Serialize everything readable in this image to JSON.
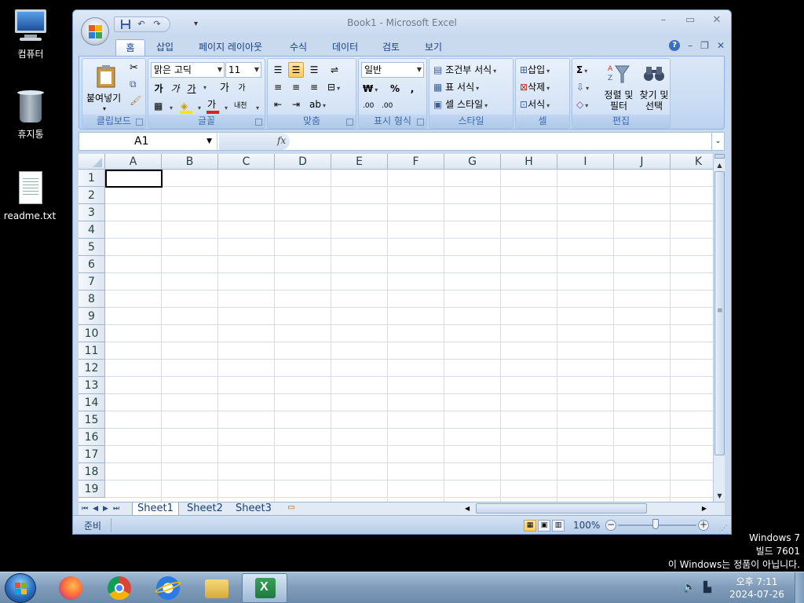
{
  "desktop": {
    "icons": [
      {
        "label": "컴퓨터"
      },
      {
        "label": "휴지통"
      },
      {
        "label": "readme.txt"
      }
    ],
    "watermark": {
      "line1": "Windows 7",
      "line2": "빌드 7601",
      "line3": "이 Windows는 정품이 아닙니다."
    }
  },
  "excel": {
    "title": "Book1 - Microsoft Excel",
    "tabs": [
      "홈",
      "삽입",
      "페이지 레이아웃",
      "수식",
      "데이터",
      "검토",
      "보기"
    ],
    "active_tab": "홈",
    "ribbon": {
      "clipboard": {
        "label": "클립보드",
        "paste": "붙여넣기"
      },
      "font": {
        "label": "글꼴",
        "font_name": "맑은 고딕",
        "font_size": "11",
        "bold": "가",
        "italic": "가",
        "underline": "가",
        "grow": "가",
        "shrink": "가",
        "font_color": "가",
        "phonetic": "내천"
      },
      "alignment": {
        "label": "맞춤"
      },
      "number": {
        "label": "표시 형식",
        "format": "일반",
        "currency": "₩",
        "percent": "%",
        "comma": ",",
        "inc_decimal": ".00",
        "dec_decimal": ".00"
      },
      "styles": {
        "label": "스타일",
        "conditional": "조건부 서식",
        "table": "표 서식",
        "cell": "셀 스타일"
      },
      "cells": {
        "label": "셀",
        "insert": "삽입",
        "delete": "삭제",
        "format": "서식"
      },
      "editing": {
        "label": "편집",
        "sort_line1": "정렬 및",
        "sort_line2": "필터",
        "find_line1": "찾기 및",
        "find_line2": "선택"
      }
    },
    "formula_bar": {
      "name_box": "A1",
      "fx": "fx",
      "formula": ""
    },
    "columns": [
      "A",
      "B",
      "C",
      "D",
      "E",
      "F",
      "G",
      "H",
      "I",
      "J",
      "K"
    ],
    "rows": [
      "1",
      "2",
      "3",
      "4",
      "5",
      "6",
      "7",
      "8",
      "9",
      "10",
      "11",
      "12",
      "13",
      "14",
      "15",
      "16",
      "17",
      "18",
      "19"
    ],
    "sheets": [
      "Sheet1",
      "Sheet2",
      "Sheet3"
    ],
    "active_sheet": "Sheet1",
    "status": {
      "text": "준비",
      "zoom": "100%"
    }
  },
  "taskbar": {
    "apps": [
      {
        "name": "firefox-icon",
        "color": "#e8662a"
      },
      {
        "name": "chrome-icon",
        "color": "#3a9a3a"
      },
      {
        "name": "ie-icon",
        "color": "#2c7be5"
      },
      {
        "name": "explorer-icon",
        "color": "#e9c14e"
      },
      {
        "name": "excel-icon",
        "color": "#1e7a3c"
      }
    ],
    "clock": {
      "time": "오후 7:11",
      "date": "2024-07-26"
    }
  }
}
